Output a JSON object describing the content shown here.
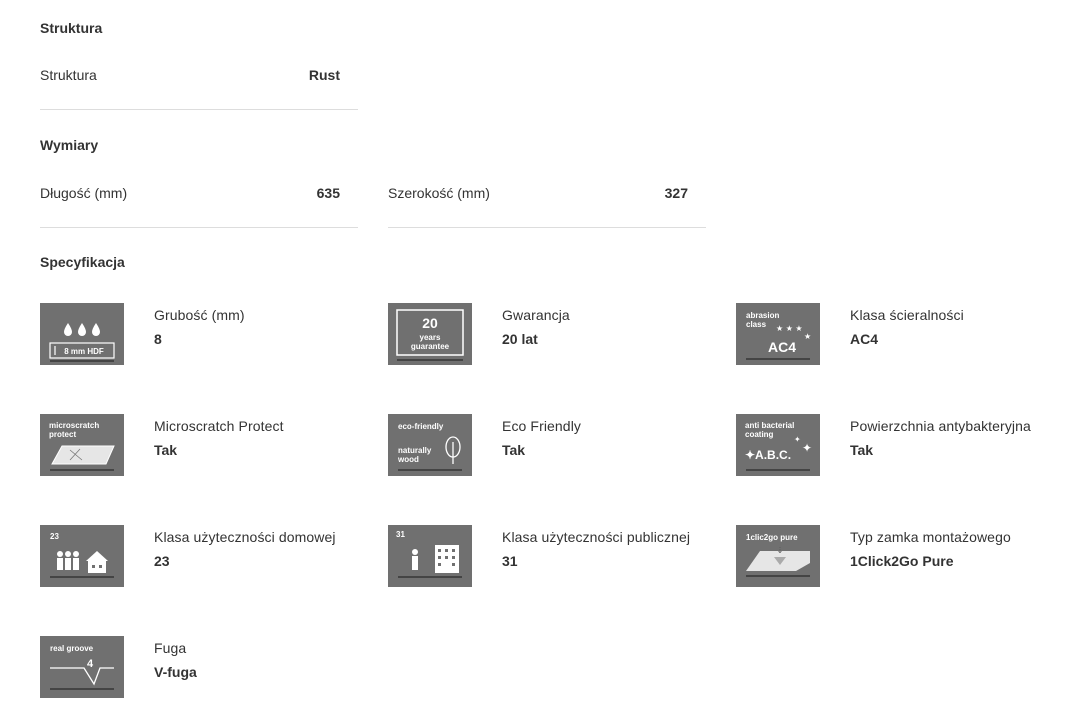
{
  "structure": {
    "title": "Struktura",
    "label": "Struktura",
    "value": "Rust"
  },
  "dimensions": {
    "title": "Wymiary",
    "length_label": "Długość (mm)",
    "length_value": "635",
    "width_label": "Szerokość (mm)",
    "width_value": "327"
  },
  "specs": {
    "title": "Specyfikacja",
    "items": [
      {
        "label": "Grubość (mm)",
        "value": "8",
        "icon": "thickness-icon",
        "icon_text": "8 mm HDF"
      },
      {
        "label": "Gwarancja",
        "value": "20 lat",
        "icon": "guarantee-icon",
        "icon_text": "20 years guarantee"
      },
      {
        "label": "Klasa ścieralności",
        "value": "AC4",
        "icon": "abrasion-class-icon",
        "icon_text": "abrasion class AC4"
      },
      {
        "label": "Microscratch Protect",
        "value": "Tak",
        "icon": "microscratch-icon",
        "icon_text": "microscratch protect"
      },
      {
        "label": "Eco Friendly",
        "value": "Tak",
        "icon": "eco-friendly-icon",
        "icon_text": "eco-friendly naturally wood"
      },
      {
        "label": "Powierzchnia antybakteryjna",
        "value": "Tak",
        "icon": "antibacterial-icon",
        "icon_text": "anti bacterial coating A.B.C."
      },
      {
        "label": "Klasa użyteczności domowej",
        "value": "23",
        "icon": "domestic-use-class-icon",
        "icon_text": "23"
      },
      {
        "label": "Klasa użyteczności publicznej",
        "value": "31",
        "icon": "public-use-class-icon",
        "icon_text": "31"
      },
      {
        "label": "Typ zamka montażowego",
        "value": "1Click2Go Pure",
        "icon": "lock-type-icon",
        "icon_text": "1clic2go pure"
      },
      {
        "label": "Fuga",
        "value": "V-fuga",
        "icon": "groove-icon",
        "icon_text": "real groove 4V"
      }
    ]
  },
  "colors": {
    "icon_bg": "#707070",
    "divider": "#dddddd",
    "text": "#333333"
  }
}
